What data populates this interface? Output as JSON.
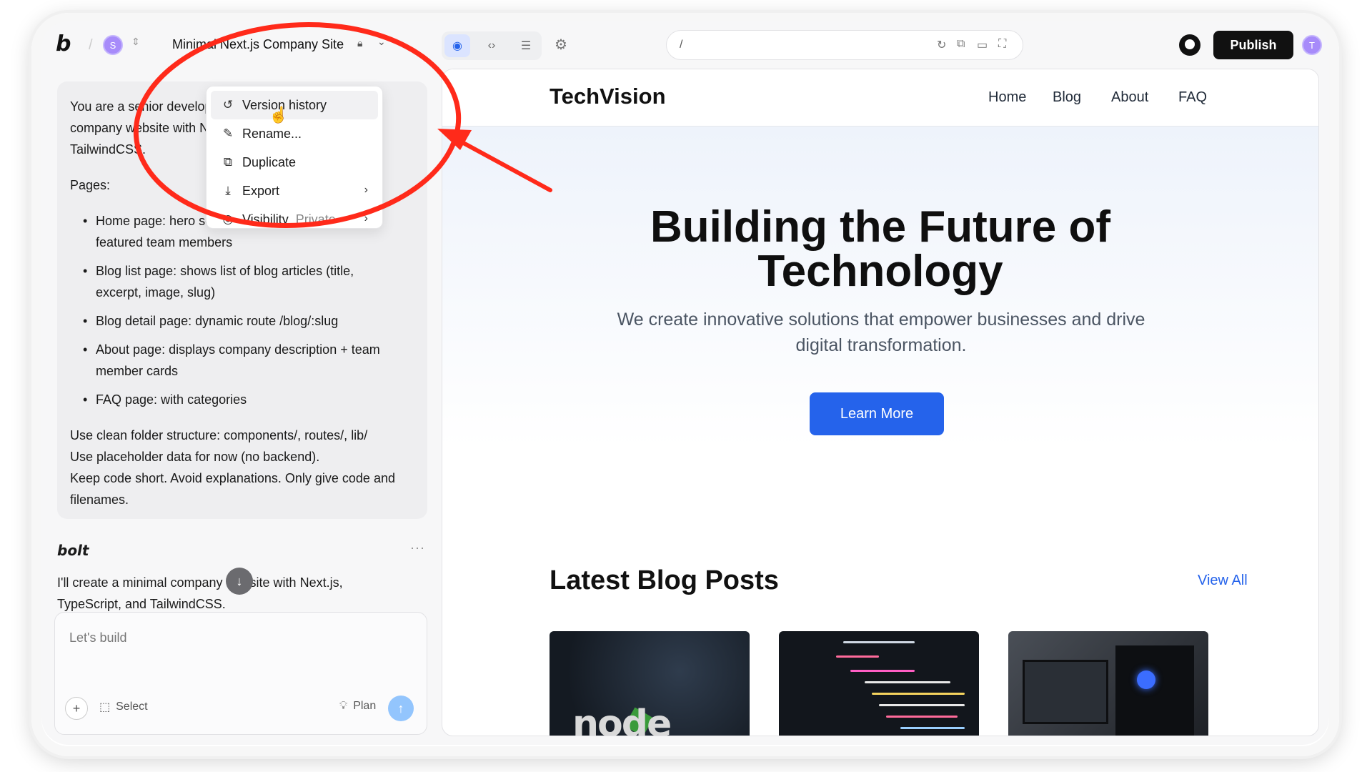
{
  "topbar": {
    "project_title": "Minimal Next.js Company Site",
    "avatar_left": "S",
    "avatar_right": "T",
    "url_path": "/",
    "publish_label": "Publish"
  },
  "menu": {
    "items": [
      {
        "label": "Version history",
        "icon": "history-icon"
      },
      {
        "label": "Rename...",
        "icon": "pencil-icon"
      },
      {
        "label": "Duplicate",
        "icon": "copy-icon"
      },
      {
        "label": "Export",
        "icon": "download-icon"
      },
      {
        "label": "Visibility",
        "icon": "eye-icon",
        "sub": "Private"
      }
    ]
  },
  "prompt": {
    "intro_lines": [
      "You are a senior developer. Build a minimal",
      "company website with Next.js, TypeScript, and",
      "TailwindCSS."
    ],
    "pages_heading": "Pages:",
    "pages": [
      [
        "Home page: hero section, latest 3 blog posts,",
        "featured team members"
      ],
      [
        "Blog list page: shows list of blog articles (title,",
        "excerpt, image, slug)"
      ],
      [
        "Blog detail page: dynamic route /blog/:slug"
      ],
      [
        "About page: displays company description + team",
        "member cards"
      ],
      [
        "FAQ page: with categories"
      ]
    ],
    "outro_lines": [
      "Use clean folder structure: components/,  routes/, lib/",
      "Use placeholder data for now (no backend).",
      "Keep code short. Avoid explanations. Only give code and",
      "filenames."
    ]
  },
  "assistant": {
    "name": "bolt",
    "reply_lines": [
      "I'll create a minimal company website with Next.js,",
      "TypeScript, and TailwindCSS."
    ]
  },
  "composer": {
    "placeholder": "Let's build",
    "select_label": "Select",
    "plan_label": "Plan"
  },
  "site": {
    "brand": "TechVision",
    "nav": [
      "Home",
      "Blog",
      "About",
      "FAQ"
    ],
    "hero_title_line1": "Building the Future of",
    "hero_title_line2": "Technology",
    "hero_sub_line1": "We create innovative solutions that empower businesses and drive",
    "hero_sub_line2": "digital transformation.",
    "cta": "Learn More",
    "section_title": "Latest Blog Posts",
    "view_all": "View All",
    "post1_logo_text": "node"
  },
  "colors": {
    "accent": "#2563eb",
    "annotation": "#ff2a1a"
  }
}
